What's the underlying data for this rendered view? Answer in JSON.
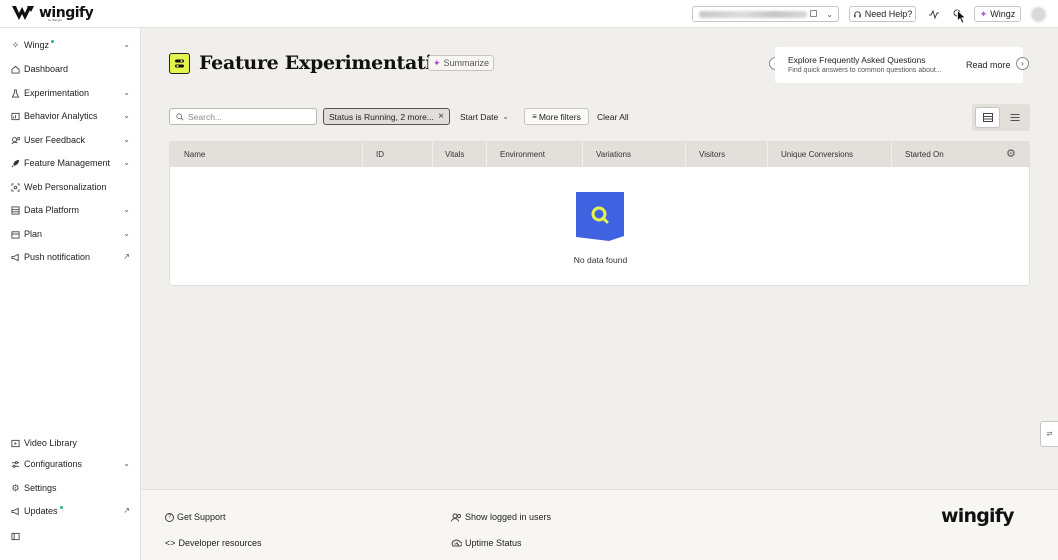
{
  "topbar": {
    "logo_text": "wingify",
    "logo_sub": "by Wingify",
    "help_label": "Need Help?",
    "wingz_label": "Wingz",
    "icons": [
      "headset-icon",
      "activity-icon",
      "search-icon",
      "sparkle-icon"
    ]
  },
  "sidebar": {
    "items": [
      {
        "label": "Wingz",
        "icon": "sparkle-icon",
        "chevron": true,
        "dot": true
      },
      {
        "label": "Dashboard",
        "icon": "home-icon",
        "chevron": false
      },
      {
        "label": "Experimentation",
        "icon": "flask-icon",
        "chevron": true
      },
      {
        "label": "Behavior Analytics",
        "icon": "analytics-icon",
        "chevron": true
      },
      {
        "label": "User Feedback",
        "icon": "feedback-icon",
        "chevron": true
      },
      {
        "label": "Feature Management",
        "icon": "rocket-icon",
        "chevron": true
      },
      {
        "label": "Web Personalization",
        "icon": "target-icon",
        "chevron": false
      },
      {
        "label": "Data Platform",
        "icon": "database-icon",
        "chevron": true
      },
      {
        "label": "Plan",
        "icon": "calendar-icon",
        "chevron": true
      },
      {
        "label": "Push notification",
        "icon": "megaphone-icon",
        "external": true
      }
    ],
    "bottom_items": [
      {
        "label": "Video Library",
        "icon": "video-icon"
      },
      {
        "label": "Configurations",
        "icon": "sliders-icon",
        "chevron": true
      },
      {
        "label": "Settings",
        "icon": "gear-icon"
      },
      {
        "label": "Updates",
        "icon": "megaphone-icon",
        "dot": true,
        "external": true
      }
    ]
  },
  "page": {
    "title": "Feature Experimentation",
    "summarize_label": "Summarize"
  },
  "faq": {
    "title": "Explore Frequently Asked Questions",
    "subtitle": "Find quick answers to common questions about...",
    "read_more": "Read more"
  },
  "filters": {
    "search_placeholder": "Search...",
    "status_chip": "Status is Running,  2 more...",
    "start_date": "Start Date",
    "more_filters": "More filters",
    "clear_all": "Clear All"
  },
  "table": {
    "columns": [
      "Name",
      "ID",
      "Vitals",
      "Environment",
      "Variations",
      "Visitors",
      "Unique Conversions",
      "Started On"
    ],
    "empty_text": "No data found"
  },
  "footer": {
    "get_support": "Get Support",
    "developer_resources": "Developer resources",
    "show_logged_users": "Show logged in users",
    "uptime_status": "Uptime Status",
    "logo_text": "wingify"
  },
  "colors": {
    "accent_yellow": "#e6f24d",
    "empty_blue": "#3f63e0",
    "main_bg": "#f1efeb",
    "header_bg": "#e3e0db",
    "dot_green": "#2bb673"
  }
}
